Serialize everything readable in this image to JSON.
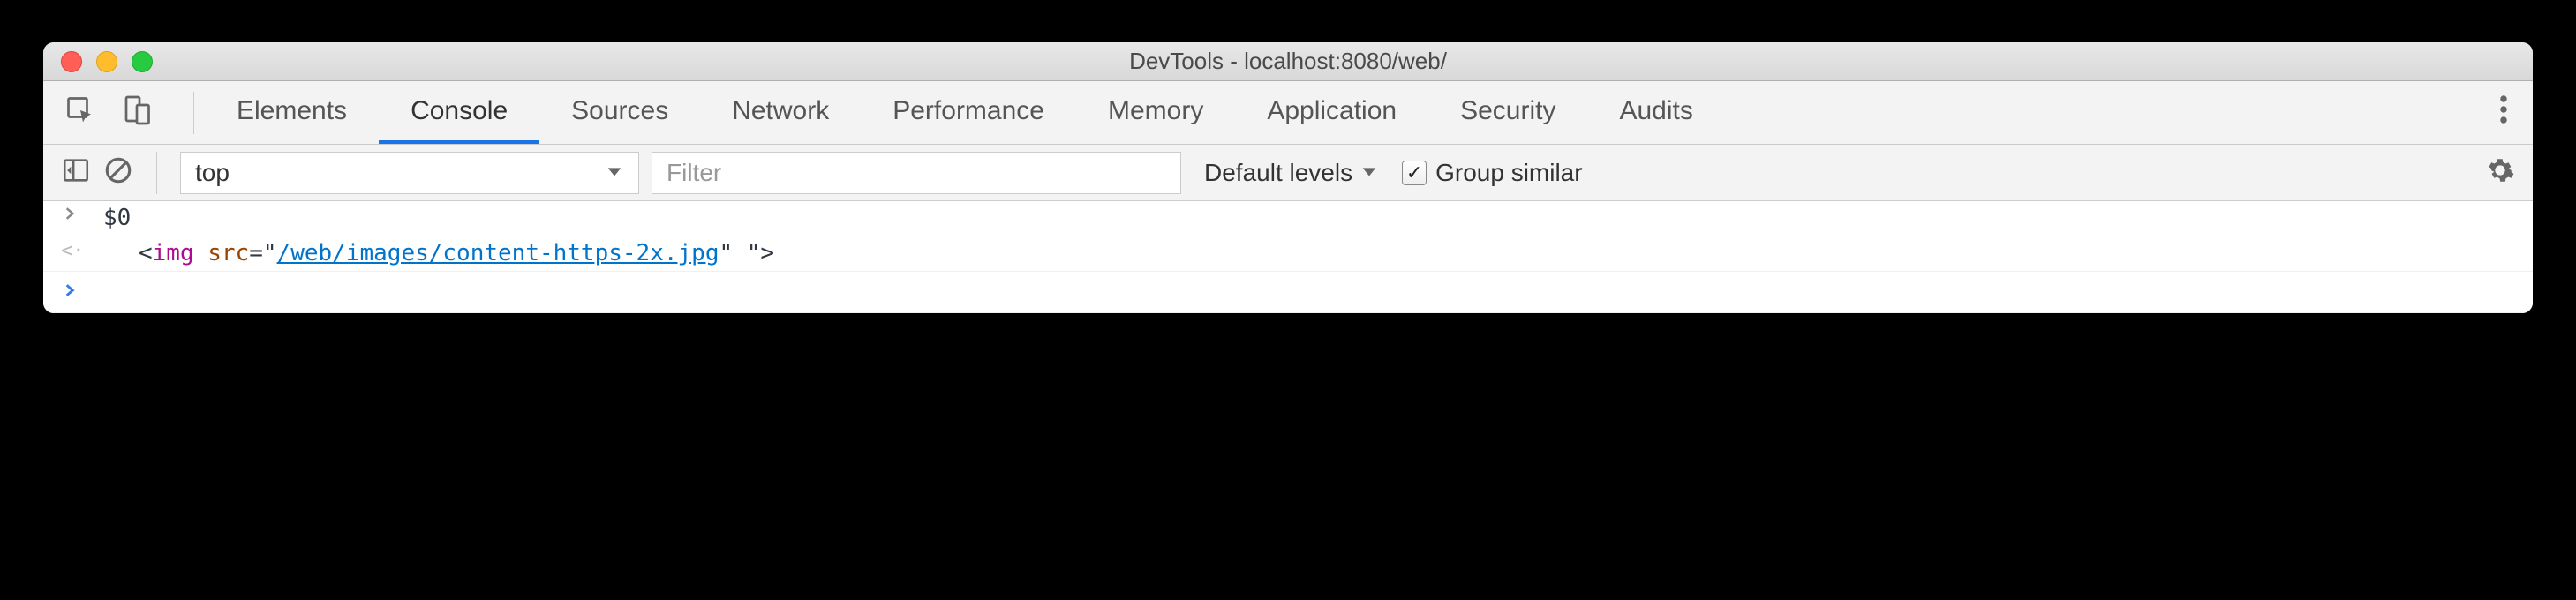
{
  "window": {
    "title": "DevTools - localhost:8080/web/"
  },
  "tabs": {
    "items": [
      {
        "label": "Elements",
        "active": false
      },
      {
        "label": "Console",
        "active": true
      },
      {
        "label": "Sources",
        "active": false
      },
      {
        "label": "Network",
        "active": false
      },
      {
        "label": "Performance",
        "active": false
      },
      {
        "label": "Memory",
        "active": false
      },
      {
        "label": "Application",
        "active": false
      },
      {
        "label": "Security",
        "active": false
      },
      {
        "label": "Audits",
        "active": false
      }
    ]
  },
  "filterbar": {
    "context": "top",
    "filter_placeholder": "Filter",
    "levels": "Default levels",
    "group_similar": "Group similar",
    "group_similar_checked": true
  },
  "console": {
    "input_line": "$0",
    "output": {
      "prefix": "<",
      "tag": "img",
      "attr": "src",
      "equals": "=\"",
      "link": "/web/images/content-https-2x.jpg",
      "suffix": "\" \">"
    }
  }
}
